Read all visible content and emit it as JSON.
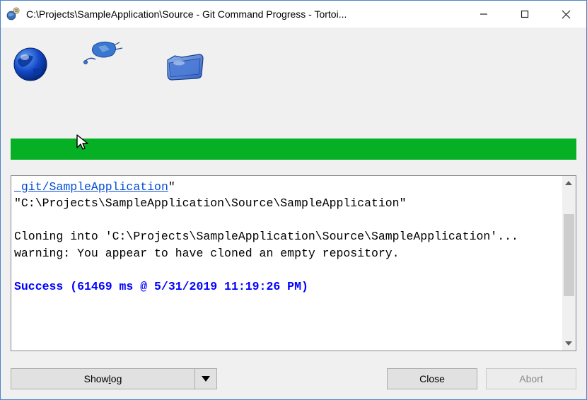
{
  "window": {
    "title": "C:\\Projects\\SampleApplication\\Source - Git Command Progress - Tortoi..."
  },
  "output": {
    "link_fragment": " git/SampleApplication",
    "line1_rest": "\" \"C:\\Projects\\SampleApplication\\Source\\SampleApplication\"",
    "blank": "",
    "line3": "Cloning into 'C:\\Projects\\SampleApplication\\Source\\SampleApplication'...",
    "line4": "warning: You appear to have cloned an empty repository.",
    "success": "Success (61469 ms @ 5/31/2019 11:19:26 PM)"
  },
  "buttons": {
    "showlog_pre": "Show ",
    "showlog_u": "l",
    "showlog_post": "og",
    "close": "Close",
    "abort": "Abort"
  }
}
